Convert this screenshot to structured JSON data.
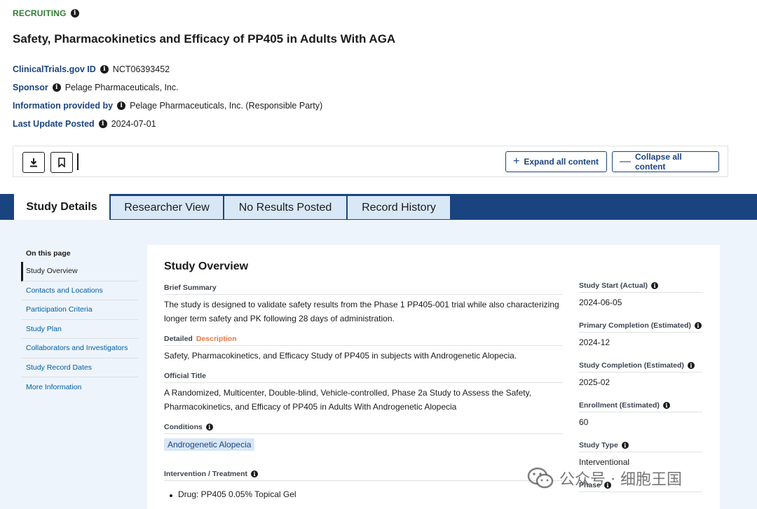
{
  "status": {
    "label": "RECRUITING"
  },
  "title": "Safety, Pharmacokinetics and Efficacy of PP405 in Adults With AGA",
  "meta": [
    {
      "label": "ClinicalTrials.gov ID",
      "value": "NCT06393452"
    },
    {
      "label": "Sponsor",
      "value": "Pelage Pharmaceuticals, Inc."
    },
    {
      "label": "Information provided by",
      "value": "Pelage Pharmaceuticals, Inc. (Responsible Party)"
    },
    {
      "label": "Last Update Posted",
      "value": "2024-07-01"
    }
  ],
  "toolbar": {
    "download_icon": "download-icon",
    "bookmark_icon": "bookmark-icon",
    "expand_label": "Expand all content",
    "collapse_label": "Collapse all content"
  },
  "tabs": [
    {
      "label": "Study Details"
    },
    {
      "label": "Researcher View"
    },
    {
      "label": "No Results Posted"
    },
    {
      "label": "Record History"
    }
  ],
  "sidebar": {
    "heading": "On this page",
    "items": [
      {
        "label": "Study Overview"
      },
      {
        "label": "Contacts and Locations"
      },
      {
        "label": "Participation Criteria"
      },
      {
        "label": "Study Plan"
      },
      {
        "label": "Collaborators and Investigators"
      },
      {
        "label": "Study Record Dates"
      },
      {
        "label": "More Information"
      }
    ]
  },
  "overview": {
    "title": "Study Overview",
    "brief_summary_label": "Brief Summary",
    "brief_summary": "The study is designed to validate safety results from the Phase 1 PP405-001 trial while also characterizing longer term safety and PK following 28 days of administration.",
    "detailed_label_a": "Detailed",
    "detailed_label_b": "Description",
    "detailed_description": "Safety, Pharmacokinetics, and Efficacy Study of PP405 in subjects with Androgenetic Alopecia.",
    "official_title_label": "Official Title",
    "official_title": "A Randomized, Multicenter, Double-blind, Vehicle-controlled, Phase 2a Study to Assess the Safety, Pharmacokinetics, and Efficacy of PP405 in Adults With Androgenetic Alopecia",
    "conditions_label": "Conditions",
    "condition": "Androgenetic Alopecia",
    "intervention_label": "Intervention / Treatment",
    "intervention": "Drug: PP405 0.05% Topical Gel"
  },
  "facts": [
    {
      "label": "Study Start (Actual)",
      "value": "2024-06-05"
    },
    {
      "label": "Primary Completion (Estimated)",
      "value": "2024-12"
    },
    {
      "label": "Study Completion (Estimated)",
      "value": "2025-02"
    },
    {
      "label": "Enrollment (Estimated)",
      "value": "60"
    },
    {
      "label": "Study Type",
      "value": "Interventional"
    },
    {
      "label": "Phase",
      "value": ""
    }
  ],
  "watermark": {
    "text": "公众号 · 细胞王国"
  },
  "colors": {
    "primary": "#1a4480",
    "link": "#005ea2",
    "status": "#2e7d32",
    "accent": "#e5774a",
    "tab_bg": "#d9e8f6"
  }
}
